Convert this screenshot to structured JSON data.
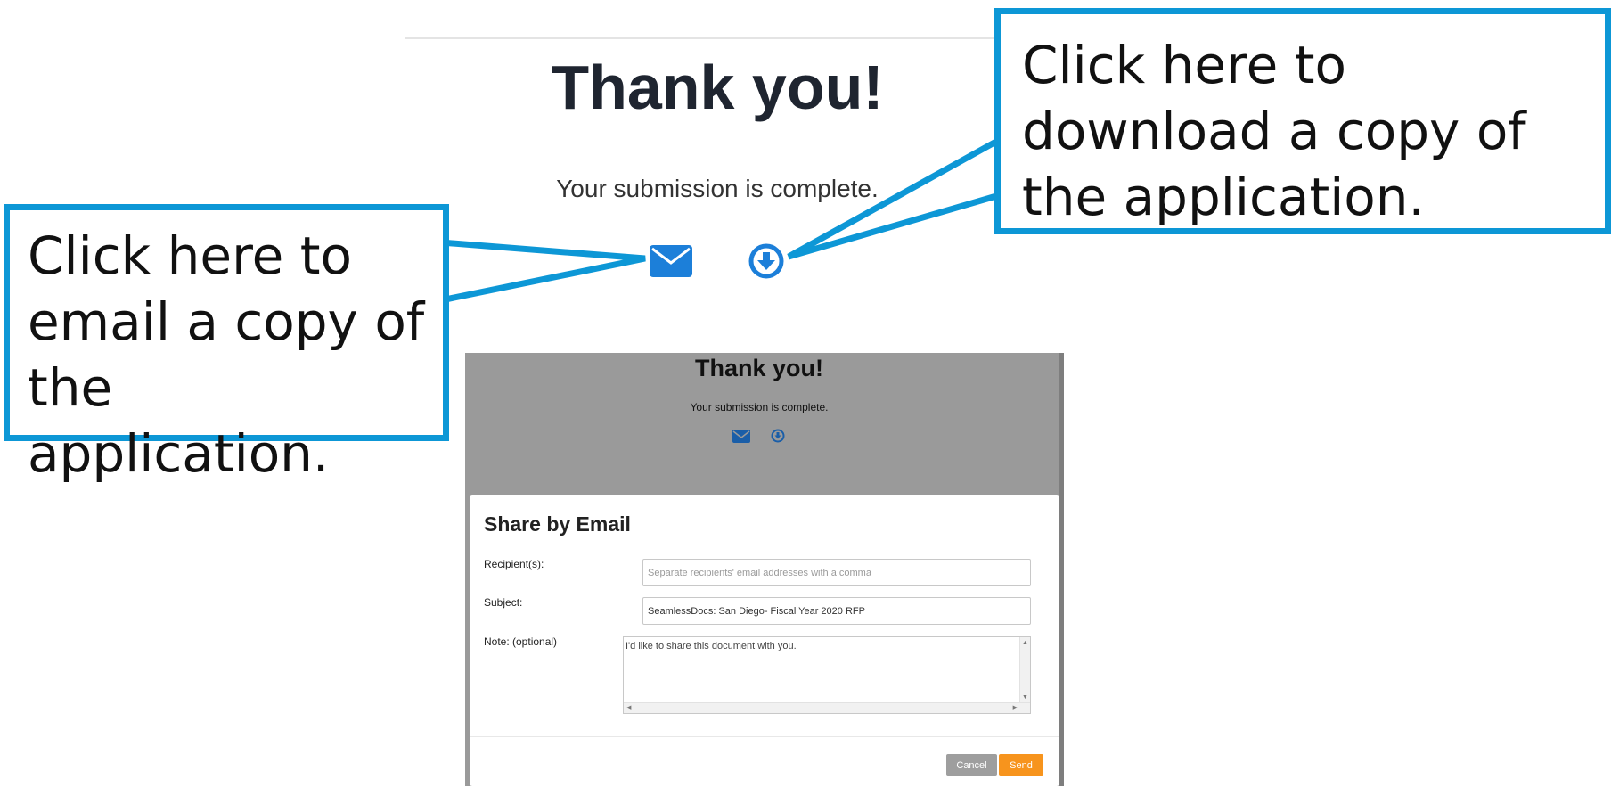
{
  "hero": {
    "title": "Thank you!",
    "subtitle": "Your submission is complete.",
    "email_icon": "envelope-icon",
    "download_icon": "download-circle-icon"
  },
  "callouts": {
    "email": "Click here to email a copy of the application.",
    "download": "Click here to download a copy of the application."
  },
  "dialog_screenshot": {
    "title": "Thank you!",
    "subtitle": "Your submission is complete.",
    "modal": {
      "title": "Share by Email",
      "recipients_label": "Recipient(s):",
      "recipients_placeholder": "Separate recipients' email addresses with a comma",
      "recipients_value": "",
      "subject_label": "Subject:",
      "subject_value": "SeamlessDocs: San Diego- Fiscal Year 2020 RFP",
      "note_label": "Note: (optional)",
      "note_value": "I'd like to share this document with you.",
      "cancel_label": "Cancel",
      "send_label": "Send"
    }
  },
  "colors": {
    "callout_border": "#0d97d6",
    "icon_blue": "#1c7fd9",
    "send_button": "#f7941d",
    "cancel_button": "#9e9e9e",
    "overlay": "#9a9a9a"
  }
}
